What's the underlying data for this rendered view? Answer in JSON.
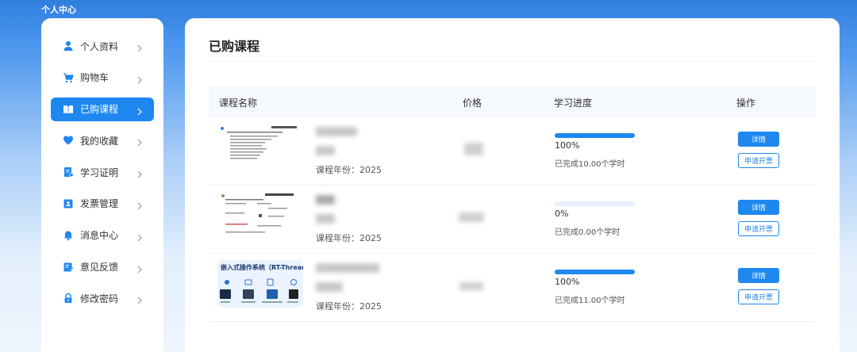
{
  "app": {
    "title": "个人中心"
  },
  "sidebar": {
    "items": [
      {
        "label": "个人资料",
        "icon": "user-icon",
        "active": false
      },
      {
        "label": "购物车",
        "icon": "cart-icon",
        "active": false
      },
      {
        "label": "已购课程",
        "icon": "book-icon",
        "active": true
      },
      {
        "label": "我的收藏",
        "icon": "heart-icon",
        "active": false
      },
      {
        "label": "学习证明",
        "icon": "certificate-icon",
        "active": false
      },
      {
        "label": "发票管理",
        "icon": "invoice-icon",
        "active": false
      },
      {
        "label": "消息中心",
        "icon": "bell-icon",
        "active": false
      },
      {
        "label": "意见反馈",
        "icon": "feedback-icon",
        "active": false
      },
      {
        "label": "修改密码",
        "icon": "lock-icon",
        "active": false
      }
    ]
  },
  "main": {
    "title": "已购课程",
    "table": {
      "headers": [
        "课程名称",
        "价格",
        "学习进度",
        "操作"
      ],
      "rows": [
        {
          "year": "课程年份：2025",
          "progress": 1.0,
          "progress_text": "100%",
          "completed": "已完成10.00个学时",
          "detail_label": "详情",
          "invoice_label": "申请开票"
        },
        {
          "year": "课程年份：2025",
          "progress": 0.0,
          "progress_text": "0%",
          "completed": "已完成0.00个学时",
          "detail_label": "详情",
          "invoice_label": "申请开票"
        },
        {
          "year": "课程年份：2025",
          "progress": 1.0,
          "progress_text": "100%",
          "completed": "已完成11.00个学时",
          "detail_label": "详情",
          "invoice_label": "申请开票",
          "thumb_title": "嵌入式操作系统（RT-Thread）"
        }
      ]
    }
  },
  "colors": {
    "accent": "#1e87f0",
    "track": "#e8f1fb"
  }
}
